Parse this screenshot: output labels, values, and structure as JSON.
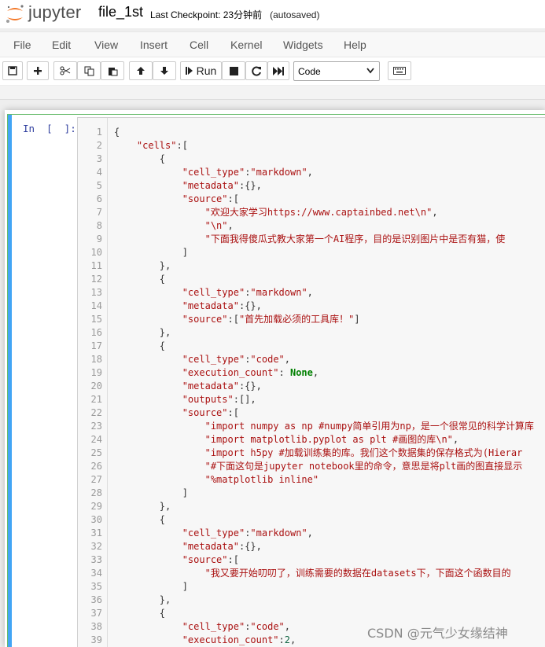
{
  "header": {
    "logo_text": "jupyter",
    "notebook_name": "file_1st",
    "checkpoint_label": "Last Checkpoint: 23分钟前",
    "autosave_status": "(autosaved)"
  },
  "menubar": [
    "File",
    "Edit",
    "View",
    "Insert",
    "Cell",
    "Kernel",
    "Widgets",
    "Help"
  ],
  "toolbar": {
    "run_label": "Run",
    "cell_type_selected": "Code",
    "icons": [
      "save-icon",
      "plus-icon",
      "cut-icon",
      "copy-icon",
      "paste-icon",
      "arrow-up-icon",
      "arrow-down-icon",
      "step-forward-icon",
      "stop-icon",
      "restart-icon",
      "fast-forward-icon",
      "keyboard-icon"
    ]
  },
  "cell": {
    "prompt": "In  [  ]:"
  },
  "code_lines": [
    "{",
    "    \"cells\":[",
    "        {",
    "            \"cell_type\":\"markdown\",",
    "            \"metadata\":{},",
    "            \"source\":[",
    "                \"欢迎大家学习https://www.captainbed.net\\n\",",
    "                \"\\n\",",
    "                \"下面我得傻瓜式教大家第一个AI程序，目的是识别图片中是否有猫，使",
    "            ]",
    "        },",
    "        {",
    "            \"cell_type\":\"markdown\",",
    "            \"metadata\":{},",
    "            \"source\":[\"首先加载必须的工具库！\"]",
    "        },",
    "        {",
    "            \"cell_type\":\"code\",",
    "            \"execution_count\": None,",
    "            \"metadata\":{},",
    "            \"outputs\":[],",
    "            \"source\":[",
    "                \"import numpy as np #numpy简单引用为np，是一个很常见的科学计算库",
    "                \"import matplotlib.pyplot as plt #画图的库\\n\",",
    "                \"import h5py #加载训练集的库。我们这个数据集的保存格式为(Hierar",
    "                \"#下面这句是jupyter notebook里的命令，意思是将plt画的图直接显示",
    "                \"%matplotlib inline\"",
    "            ]",
    "        },",
    "        {",
    "            \"cell_type\":\"markdown\",",
    "            \"metadata\":{},",
    "            \"source\":[",
    "                \"我又要开始叨叨了，训练需要的数据在datasets下，下面这个函数目的",
    "            ]",
    "        },",
    "        {",
    "            \"cell_type\":\"code\",",
    "            \"execution_count\":2,",
    "            \"metadata\":{},"
  ],
  "watermark": "CSDN @元气少女缘结神"
}
